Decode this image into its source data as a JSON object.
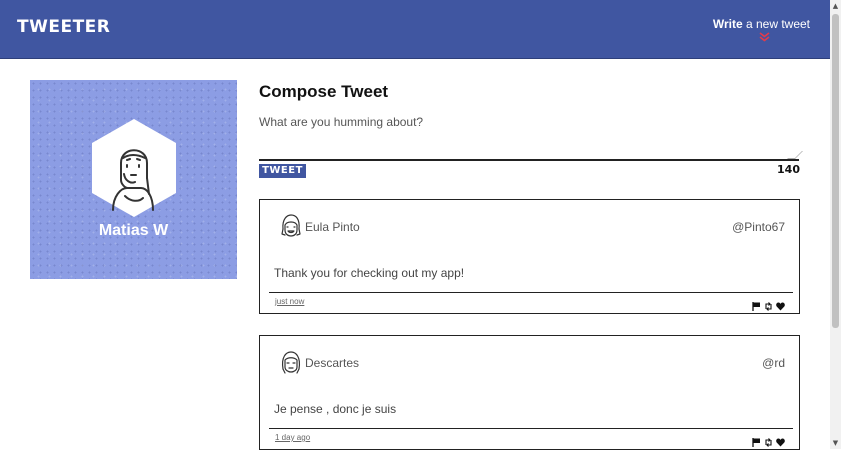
{
  "nav": {
    "brand": "TWEETER",
    "compose_bold": "Write",
    "compose_rest": " a new tweet",
    "arrow": "»"
  },
  "profile": {
    "name": "Matias W",
    "background_color": "#8c9de4"
  },
  "compose": {
    "title": "Compose Tweet",
    "placeholder": "What are you humming about?",
    "button_label": "TWEET",
    "counter": "140"
  },
  "tweets": [
    {
      "name": "Eula Pinto",
      "handle": "@Pinto67",
      "body": "Thank you for checking out my app!",
      "time": "just now",
      "avatar_icon": "smiling-girl-avatar-icon"
    },
    {
      "name": "Descartes",
      "handle": "@rd",
      "body": "Je pense , donc je suis",
      "time": "1 day ago",
      "avatar_icon": "long-hair-man-avatar-icon"
    }
  ],
  "actions": [
    "flag-icon",
    "retweet-icon",
    "heart-icon"
  ],
  "colors": {
    "navbar": "#4056a1",
    "accent_arrow": "#e23b4a"
  }
}
